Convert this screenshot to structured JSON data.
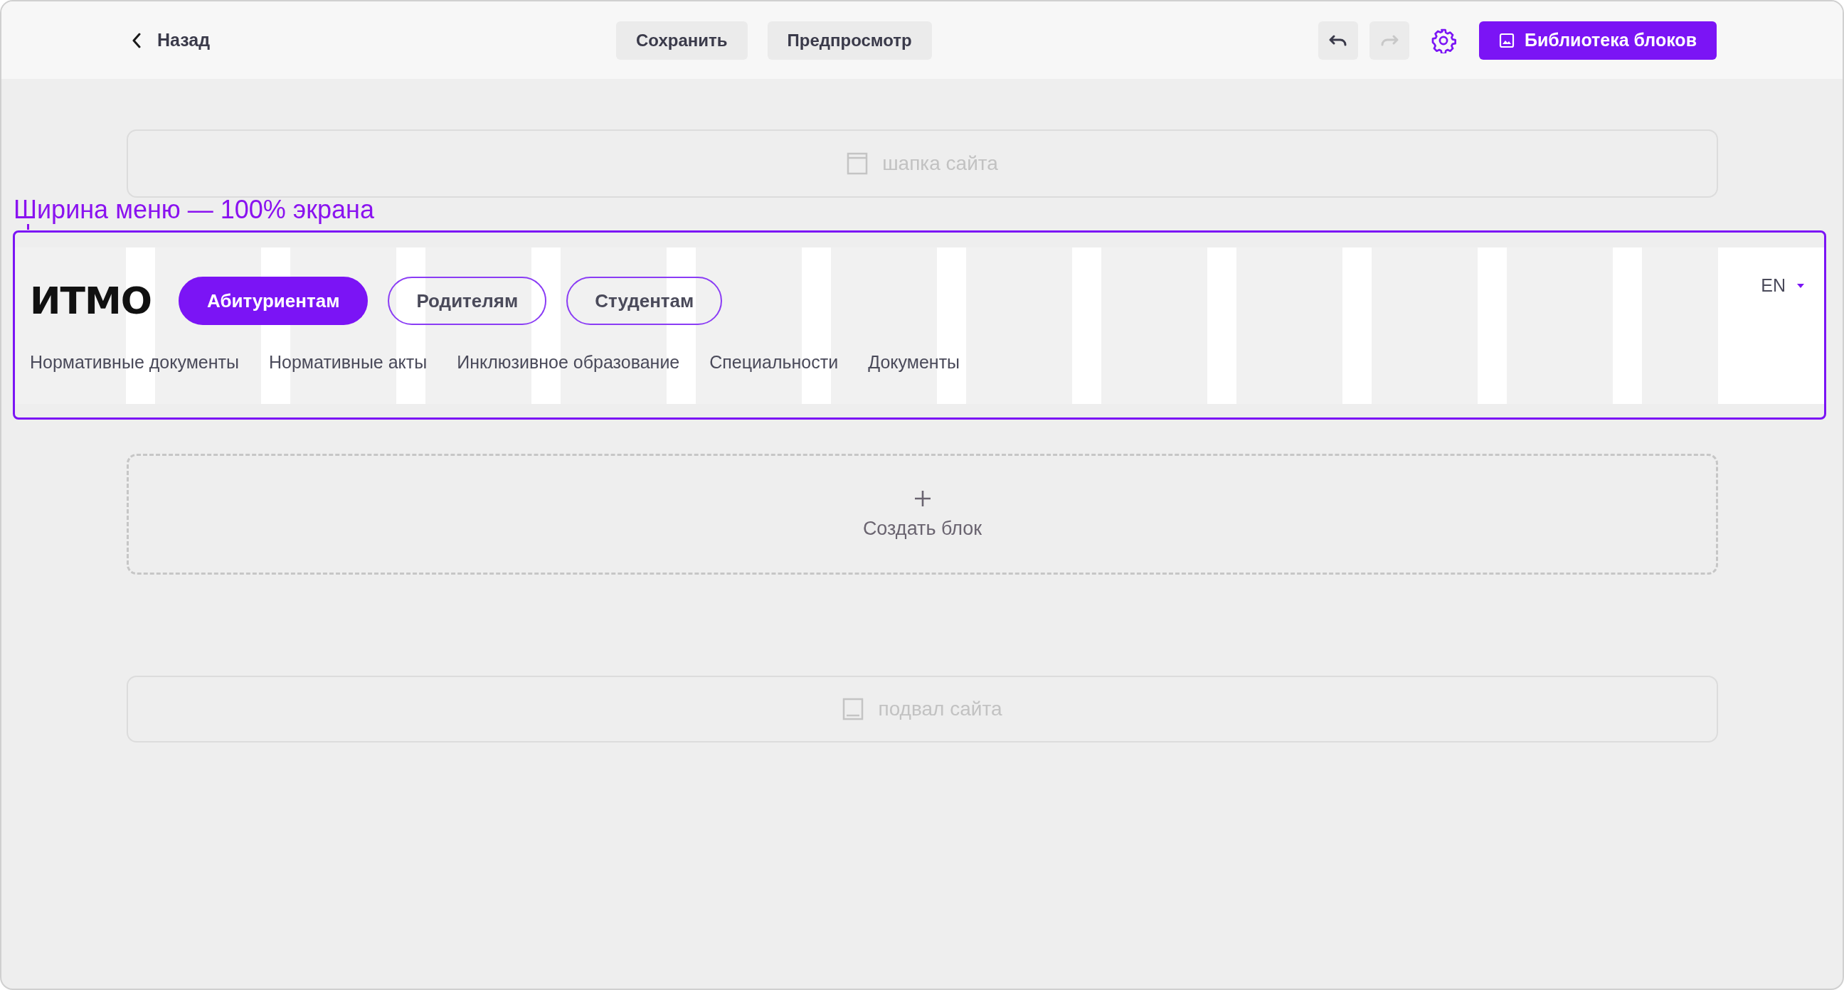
{
  "toolbar": {
    "back": "Назад",
    "buttons": [
      {
        "label": "Сохранить"
      },
      {
        "label": "Предпросмотр"
      }
    ],
    "history": [
      {
        "kind": "undo",
        "disabled": false
      },
      {
        "kind": "redo",
        "disabled": true
      }
    ],
    "library_button": "Библиотека блоков"
  },
  "header_block": {
    "label": "шапка сайта"
  },
  "annotation": "Ширина меню — 100% экрана",
  "menu": {
    "logo": "ИTMO",
    "audience_tabs": [
      {
        "label": "Абитуриентам",
        "selected": true
      },
      {
        "label": "Родителям",
        "selected": false
      },
      {
        "label": "Студентам",
        "selected": false
      }
    ],
    "links": [
      "Нормативные документы",
      "Нормативные акты",
      "Инклюзивное образование",
      "Специальности",
      "Документы"
    ],
    "language": "EN"
  },
  "create_block": {
    "label": "Создать блок"
  },
  "footer_block": {
    "label": "подвал сайта"
  }
}
